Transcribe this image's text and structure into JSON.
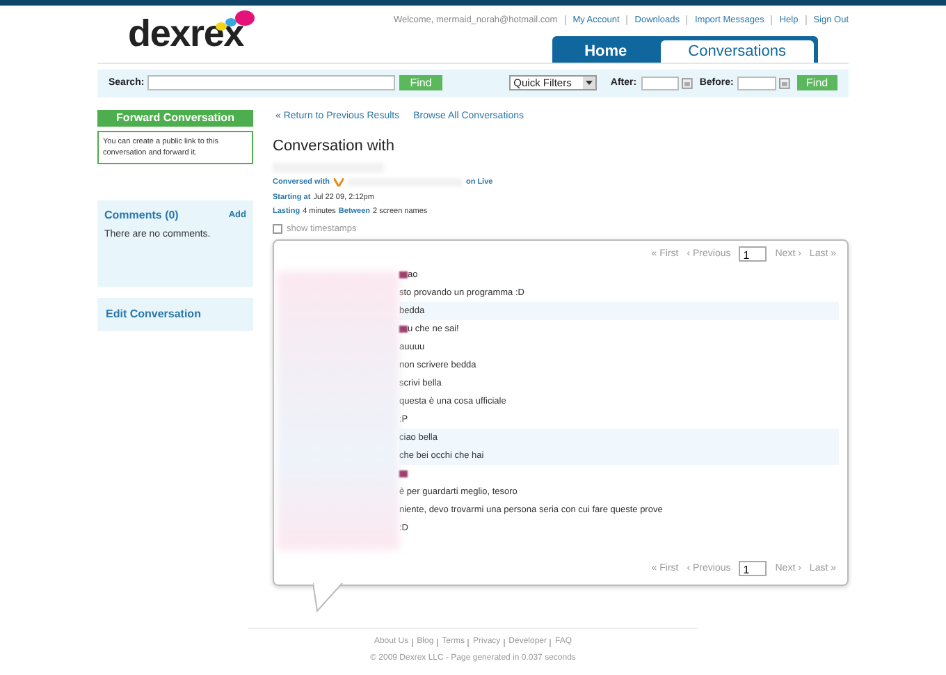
{
  "header": {
    "welcome": "Welcome, mermaid_norah@hotmail.com",
    "links": [
      "My Account",
      "Downloads",
      "Import Messages",
      "Help",
      "Sign Out"
    ],
    "logo": "dexrex",
    "tabs": [
      {
        "label": "Home",
        "selected": false
      },
      {
        "label": "Conversations",
        "selected": true
      }
    ]
  },
  "search_bar": {
    "label": "Search:",
    "find": "Find",
    "quick_filters": "Quick Filters",
    "after": "After:",
    "before": "Before:",
    "find2": "Find"
  },
  "sidebar": {
    "forward_button": "Forward Conversation",
    "forward_text": "You can create a public link to this conversation and forward it.",
    "comments_title": "Comments (0)",
    "comments_add": "Add",
    "comments_empty": "There are no comments.",
    "edit": "Edit Conversation"
  },
  "nav": [
    "« Return to Previous Results",
    "Browse All Conversations"
  ],
  "title": "Conversation with",
  "meta": {
    "conversed_label": "Conversed with",
    "on": "on Live",
    "starting_label": "Starting at",
    "starting": "Jul 22 09, 2:12pm",
    "lasting_label": "Lasting",
    "lasting": "4 minutes",
    "between_label": "Between",
    "between": "2 screen names"
  },
  "show_timestamps": {
    "label": "show timestamps",
    "checked": false
  },
  "pager_top": {
    "first": "« First",
    "previous": "‹ Previous",
    "page": "1",
    "next": "Next ›",
    "last": "Last »"
  },
  "pager_bottom": {
    "first": "« First",
    "previous": "‹ Previous",
    "page": "1",
    "next": "Next ›",
    "last": "Last »"
  },
  "messages": [
    {
      "text": "ao",
      "redacted": true,
      "highlighted": false
    },
    {
      "text": "sto provando un programma :D",
      "redacted": false,
      "highlighted": false
    },
    {
      "text": "bedda",
      "redacted": false,
      "highlighted": true
    },
    {
      "text": "u che ne sai!",
      "redacted": true,
      "highlighted": false
    },
    {
      "text": "auuuu",
      "redacted": false,
      "highlighted": false
    },
    {
      "text": "non scrivere bedda",
      "redacted": false,
      "highlighted": false
    },
    {
      "text": "scrivi bella",
      "redacted": false,
      "highlighted": false
    },
    {
      "text": "questa è una cosa ufficiale",
      "redacted": false,
      "highlighted": false
    },
    {
      "text": ":P",
      "redacted": false,
      "highlighted": false
    },
    {
      "text": "ciao bella",
      "redacted": false,
      "highlighted": true
    },
    {
      "text": "che bei occhi che hai",
      "redacted": false,
      "highlighted": true
    },
    {
      "redacted": true,
      "highlighted": false
    },
    {
      "text": "è per guardarti meglio, tesoro",
      "redacted": false,
      "highlighted": false
    },
    {
      "text": "niente, devo trovarmi una persona seria con cui fare queste prove",
      "redacted": false,
      "highlighted": false
    },
    {
      "text": ":D",
      "redacted": false,
      "highlighted": false
    }
  ],
  "footer": {
    "links": [
      "About Us",
      "Blog",
      "Terms",
      "Privacy",
      "Developer",
      "FAQ"
    ],
    "copyright": "© 2009 Dexrex LLC - Page generated in 0.037 seconds"
  }
}
